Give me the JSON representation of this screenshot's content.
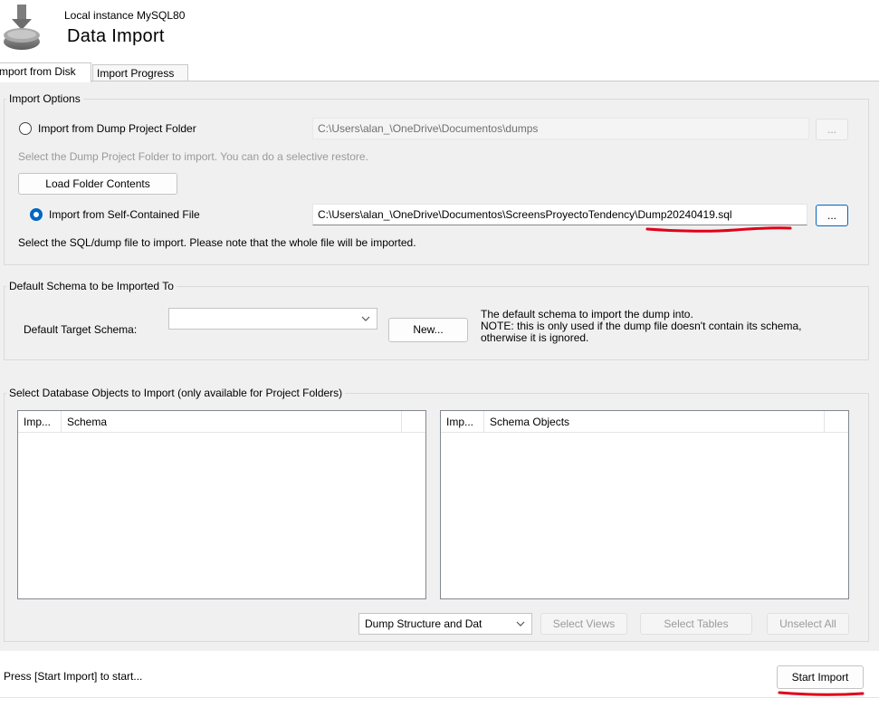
{
  "header": {
    "icon": "database-import-icon",
    "instance": "Local instance MySQL80",
    "title": "Data Import"
  },
  "tabs": [
    {
      "label": "mport from Disk",
      "selected": true
    },
    {
      "label": "Import Progress",
      "selected": false
    }
  ],
  "import_options": {
    "title": "Import Options",
    "dump_folder": {
      "label": "Import from Dump Project Folder",
      "selected": false,
      "path": "C:\\Users\\alan_\\OneDrive\\Documentos\\dumps",
      "browse_label": "...",
      "hint": "Select the Dump Project Folder to import. You can do a selective restore.",
      "load_button": "Load Folder Contents"
    },
    "self_contained": {
      "label": "Import from Self-Contained File",
      "selected": true,
      "path": "C:\\Users\\alan_\\OneDrive\\Documentos\\ScreensProyectoTendency\\Dump20240419.sql",
      "browse_label": "...",
      "hint": "Select the SQL/dump file to import. Please note that the whole file will be imported."
    }
  },
  "default_schema": {
    "title": "Default Schema to be Imported To",
    "target_label": "Default Target Schema:",
    "target_value": "",
    "new_button": "New...",
    "note_1": "The default schema to import the dump into.",
    "note_2": "NOTE: this is only used if the dump file doesn't contain its schema,",
    "note_3": "otherwise it is ignored."
  },
  "objects": {
    "title": "Select Database Objects to Import (only available for Project Folders)",
    "left_list": {
      "col1": "Imp...",
      "col2": "Schema"
    },
    "right_list": {
      "col1": "Imp...",
      "col2": "Schema Objects"
    },
    "dump_mode": "Dump Structure and Dat",
    "select_views": "Select Views",
    "select_tables": "Select Tables",
    "unselect_all": "Unselect All"
  },
  "footer": {
    "status": "Press [Start Import] to start...",
    "start_button": "Start Import"
  },
  "colors": {
    "accent": "#0067c0",
    "annotation": "#e0001a"
  }
}
